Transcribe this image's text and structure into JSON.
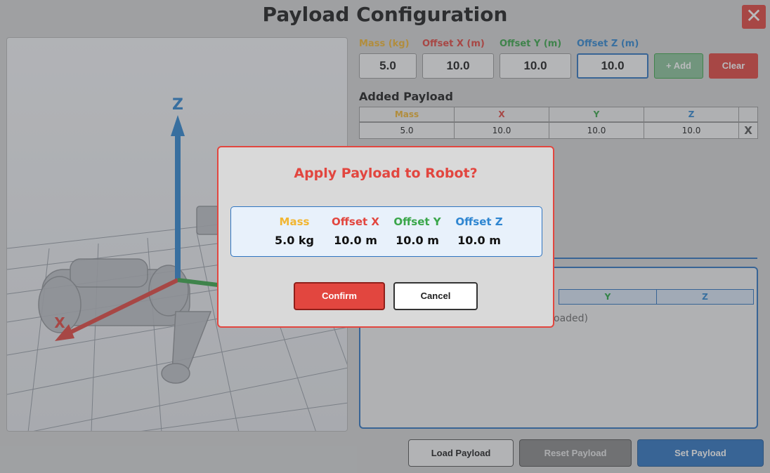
{
  "header": {
    "title": "Payload Configuration",
    "close_label": "✕"
  },
  "colors": {
    "mass": "#f2b632",
    "x": "#e2463f",
    "y": "#3aa64a",
    "z": "#2f86d1",
    "primary": "#2f74c0",
    "danger": "#e2463f"
  },
  "viewport": {
    "axis_labels": {
      "x": "X",
      "z": "Z"
    }
  },
  "inputs": {
    "mass": {
      "label": "Mass (kg)",
      "value": "5.0"
    },
    "offset_x": {
      "label": "Offset X (m)",
      "value": "10.0"
    },
    "offset_y": {
      "label": "Offset Y (m)",
      "value": "10.0"
    },
    "offset_z": {
      "label": "Offset Z (m)",
      "value": "10.0"
    },
    "add_label": "+ Add",
    "clear_label": "Clear"
  },
  "added_payload": {
    "title": "Added Payload",
    "columns": [
      "Mass",
      "X",
      "Y",
      "Z"
    ],
    "rows": [
      {
        "mass": "5.0",
        "x": "10.0",
        "y": "10.0",
        "z": "10.0",
        "remove_label": "X"
      }
    ]
  },
  "loaded_payload": {
    "columns_visible": [
      "Y",
      "Z"
    ],
    "empty_text_fragment": "oaded)"
  },
  "bottom_buttons": {
    "load": "Load Payload",
    "reset": "Reset Payload",
    "set": "Set Payload"
  },
  "modal": {
    "title": "Apply Payload to Robot?",
    "summary": [
      {
        "label": "Mass",
        "value": "5.0 kg"
      },
      {
        "label": "Offset X",
        "value": "10.0 m"
      },
      {
        "label": "Offset Y",
        "value": "10.0 m"
      },
      {
        "label": "Offset Z",
        "value": "10.0 m"
      }
    ],
    "confirm_label": "Confirm",
    "cancel_label": "Cancel"
  }
}
